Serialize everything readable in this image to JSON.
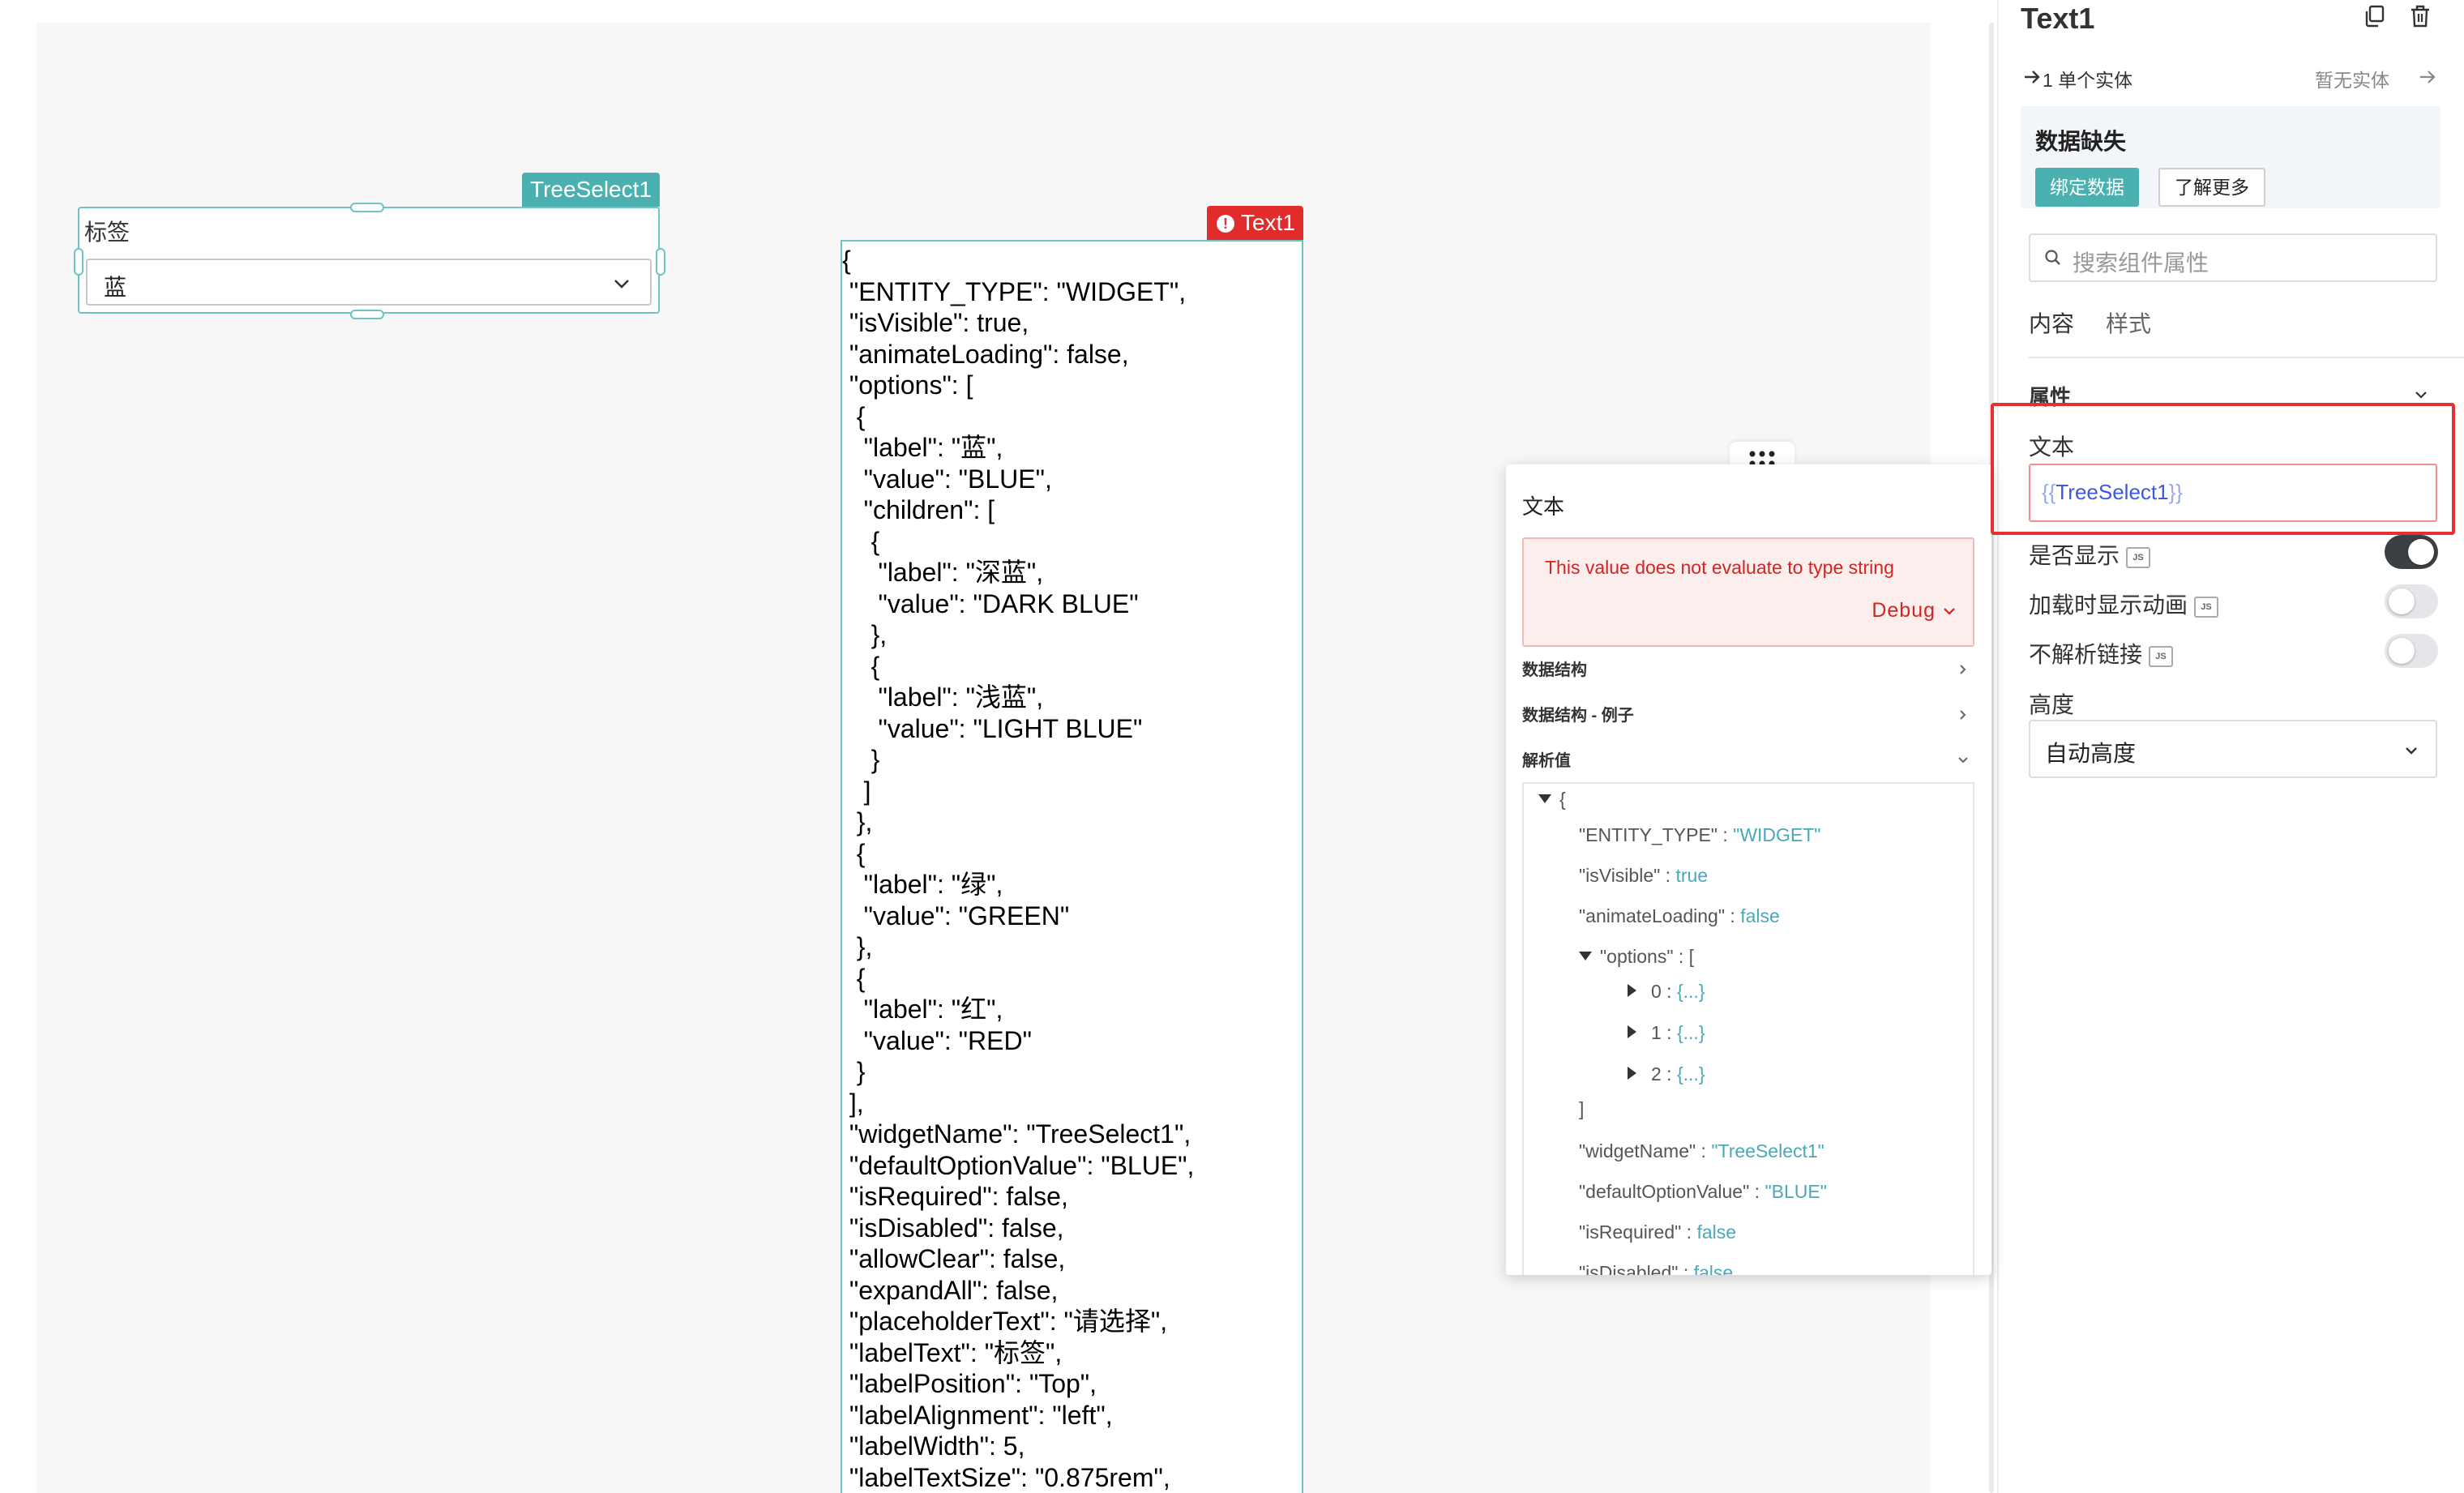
{
  "tree_select_widget": {
    "name_tag": "TreeSelect1",
    "label": "标签",
    "selected_value": "蓝",
    "chevron_icon": "chevron-down-icon"
  },
  "text_widget": {
    "name_tag": "Text1",
    "error_icon": "error-icon",
    "content": "{\n \"ENTITY_TYPE\": \"WIDGET\",\n \"isVisible\": true,\n \"animateLoading\": false,\n \"options\": [\n  {\n   \"label\": \"蓝\",\n   \"value\": \"BLUE\",\n   \"children\": [\n    {\n     \"label\": \"深蓝\",\n     \"value\": \"DARK BLUE\"\n    },\n    {\n     \"label\": \"浅蓝\",\n     \"value\": \"LIGHT BLUE\"\n    }\n   ]\n  },\n  {\n   \"label\": \"绿\",\n   \"value\": \"GREEN\"\n  },\n  {\n   \"label\": \"红\",\n   \"value\": \"RED\"\n  }\n ],\n \"widgetName\": \"TreeSelect1\",\n \"defaultOptionValue\": \"BLUE\",\n \"isRequired\": false,\n \"isDisabled\": false,\n \"allowClear\": false,\n \"expandAll\": false,\n \"placeholderText\": \"请选择\",\n \"labelText\": \"标签\",\n \"labelPosition\": \"Top\",\n \"labelAlignment\": \"left\",\n \"labelWidth\": 5,\n \"labelTextSize\": \"0.875rem\","
  },
  "evaluated_popup": {
    "drag_handle_icon": "drag-handle-icon",
    "title": "文本",
    "error_message": "This value does not evaluate to type string",
    "debug_label": "Debug",
    "sections": {
      "data_structure": "数据结构",
      "data_structure_example": "数据结构 - 例子",
      "evaluated_value": "解析值"
    },
    "tree": {
      "open_brace": "{",
      "rows": [
        {
          "key": "\"ENTITY_TYPE\"",
          "sep": " : ",
          "value": "\"WIDGET\""
        },
        {
          "key": "\"isVisible\"",
          "sep": " : ",
          "value": "true"
        },
        {
          "key": "\"animateLoading\"",
          "sep": " : ",
          "value": "false"
        }
      ],
      "options_key": "\"options\"",
      "options_sep": " : ",
      "options_open": "[",
      "option_items": [
        {
          "index": "0",
          "sep": " : ",
          "collapsed": "{...}"
        },
        {
          "index": "1",
          "sep": " : ",
          "collapsed": "{...}"
        },
        {
          "index": "2",
          "sep": " : ",
          "collapsed": "{...}"
        }
      ],
      "options_close": "]",
      "rows_after": [
        {
          "key": "\"widgetName\"",
          "sep": " : ",
          "value": "\"TreeSelect1\""
        },
        {
          "key": "\"defaultOptionValue\"",
          "sep": " : ",
          "value": "\"BLUE\""
        },
        {
          "key": "\"isRequired\"",
          "sep": " : ",
          "value": "false"
        },
        {
          "key": "\"isDisabled\"",
          "sep": " : ",
          "value": "false"
        }
      ]
    }
  },
  "property_pane": {
    "title": "Text1",
    "copy_icon": "copy-icon",
    "delete_icon": "trash-icon",
    "entity_link": "1 单个实体",
    "no_entity": "暂无实体",
    "data_missing": {
      "title": "数据缺失",
      "bind_button": "绑定数据",
      "learn_more_button": "了解更多"
    },
    "search_placeholder": "搜索组件属性",
    "tabs": [
      "内容",
      "样式"
    ],
    "active_tab": "内容",
    "section_title": "属性",
    "text_field": {
      "label": "文本",
      "open_braces": "{{",
      "binding": "TreeSelect1",
      "close_braces": "}}"
    },
    "toggles": [
      {
        "label": "是否显示",
        "badge": "JS",
        "on": true
      },
      {
        "label": "加载时显示动画",
        "badge": "JS",
        "on": false
      },
      {
        "label": "不解析链接",
        "badge": "JS",
        "on": false
      }
    ],
    "height": {
      "label": "高度",
      "value": "自动高度"
    },
    "colors": {
      "accent": "#4ab0b0",
      "error": "#e22b2b",
      "binding": "#3b5bdb"
    }
  }
}
